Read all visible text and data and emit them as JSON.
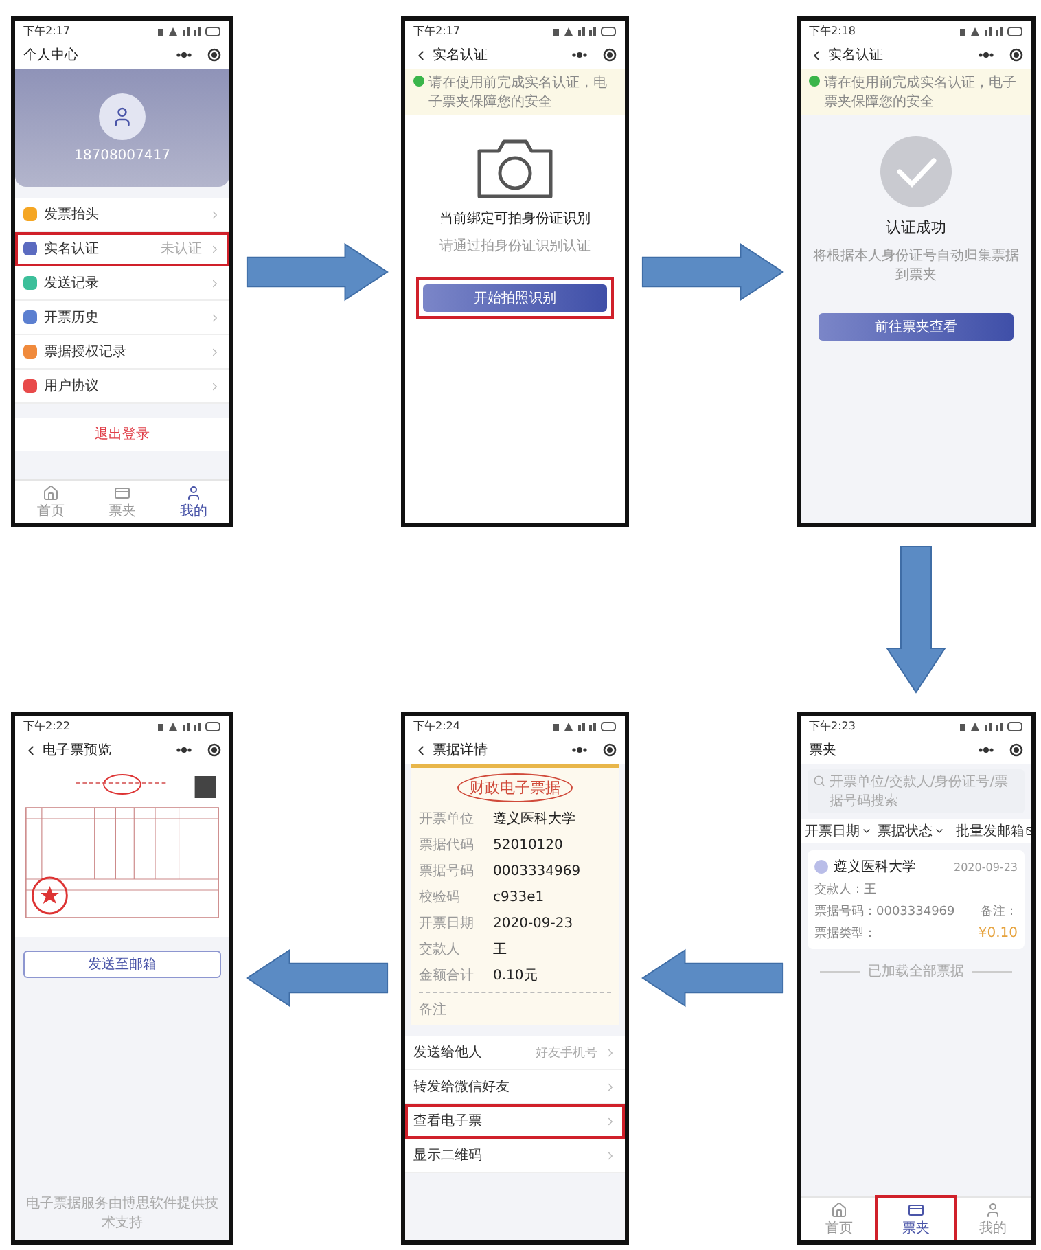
{
  "top_row": [
    {
      "kind": "profile",
      "time": "下午2:17",
      "title": "个人中心",
      "back": false,
      "phone": "18708007417",
      "menu": [
        {
          "label": "发票抬头",
          "color": "#f5a623",
          "highlighted": false
        },
        {
          "label": "实名认证",
          "value": "未认证",
          "color": "#5b6bc0",
          "highlighted": true
        },
        {
          "label": "发送记录",
          "color": "#3cbf9a",
          "highlighted": false
        },
        {
          "label": "开票历史",
          "color": "#5b7fd0",
          "highlighted": false
        },
        {
          "label": "票据授权记录",
          "color": "#f08a3c",
          "highlighted": false
        },
        {
          "label": "用户协议",
          "color": "#e84a4a",
          "highlighted": false
        }
      ],
      "logout": "退出登录",
      "tabs": [
        {
          "label": "首页",
          "selected": false,
          "highlighted": false
        },
        {
          "label": "票夹",
          "selected": false,
          "highlighted": false
        },
        {
          "label": "我的",
          "selected": true,
          "highlighted": false
        }
      ]
    },
    {
      "kind": "camera",
      "time": "下午2:17",
      "title": "实名认证",
      "back": true,
      "banner": "请在使用前完成实名认证，电子票夹保障您的安全",
      "heading": "当前绑定可拍身份证识别",
      "subtitle": "请通过拍身份证识别认证",
      "button": {
        "label": "开始拍照识别",
        "highlighted": true
      }
    },
    {
      "kind": "success",
      "time": "下午2:18",
      "title": "实名认证",
      "back": true,
      "banner": "请在使用前完成实名认证，电子票夹保障您的安全",
      "heading": "认证成功",
      "subtitle": "将根据本人身份证号自动归集票据到票夹",
      "button": {
        "label": "前往票夹查看",
        "highlighted": false
      }
    }
  ],
  "bottom_row": [
    {
      "kind": "preview",
      "time": "下午2:22",
      "title": "电子票预览",
      "back": true,
      "button": "发送至邮箱",
      "footer": "电子票据服务由博思软件提供技术支持"
    },
    {
      "kind": "detail",
      "time": "下午2:24",
      "title": "票据详情",
      "back": true,
      "header": "财政电子票据",
      "fields": [
        {
          "label": "开票单位",
          "value": "遵义医科大学"
        },
        {
          "label": "票据代码",
          "value": "52010120"
        },
        {
          "label": "票据号码",
          "value": "0003334969"
        },
        {
          "label": "校验码",
          "value": "c933e1"
        },
        {
          "label": "开票日期",
          "value": "2020-09-23"
        },
        {
          "label": "交款人",
          "value": "王"
        },
        {
          "label": "金额合计",
          "value": "0.10元"
        }
      ],
      "remark": "备注",
      "actions": [
        {
          "label": "发送给他人",
          "value": "好友手机号",
          "highlighted": false
        },
        {
          "label": "转发给微信好友",
          "highlighted": false
        },
        {
          "label": "查看电子票",
          "highlighted": true
        },
        {
          "label": "显示二维码",
          "highlighted": false
        }
      ]
    },
    {
      "kind": "wallet",
      "time": "下午2:23",
      "title": "票夹",
      "back": false,
      "search": {
        "placeholder": "开票单位/交款人/身份证号/票据号码搜索"
      },
      "filters": [
        "开票日期",
        "票据状态"
      ],
      "batch": "批量发邮箱",
      "card": {
        "name": "遵义医科大学",
        "date": "2020-09-23",
        "payer": "交款人：王",
        "number": "票据号码：0003334969",
        "type": "票据类型：",
        "remark": "备注：",
        "amount": "¥0.10"
      },
      "end_note": "已加载全部票据",
      "tabs": [
        {
          "label": "首页",
          "selected": false,
          "highlighted": false
        },
        {
          "label": "票夹",
          "selected": true,
          "highlighted": true
        },
        {
          "label": "我的",
          "selected": false,
          "highlighted": false
        }
      ]
    }
  ]
}
